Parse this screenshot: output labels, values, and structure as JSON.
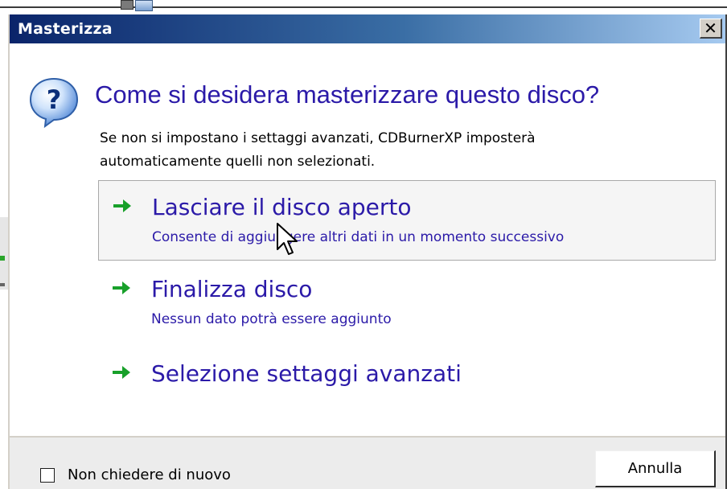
{
  "window": {
    "title": "Masterizza",
    "close_glyph": "✕"
  },
  "dialog": {
    "icon": "question-icon",
    "heading": "Come si desidera masterizzare questo disco?",
    "description_line1": "Se non si impostano i settaggi avanzati, CDBurnerXP imposterà",
    "description_line2": "automaticamente quelli non selezionati."
  },
  "options": [
    {
      "icon": "green-arrow-icon",
      "title": "Lasciare il disco aperto",
      "subtitle": "Consente di aggiungere altri dati in un momento successivo"
    },
    {
      "icon": "green-arrow-icon",
      "title": "Finalizza disco",
      "subtitle": "Nessun dato potrà essere aggiunto"
    },
    {
      "icon": "green-arrow-icon",
      "title": "Selezione settaggi avanzati"
    }
  ],
  "footer": {
    "checkbox_label": "Non chiedere di nuovo",
    "checkbox_checked": false,
    "cancel_label": "Annulla"
  },
  "colors": {
    "title_bar_start": "#0a246a",
    "title_bar_end": "#a6caf0",
    "link_text": "#2b1aa8",
    "arrow": "#18a02a"
  }
}
